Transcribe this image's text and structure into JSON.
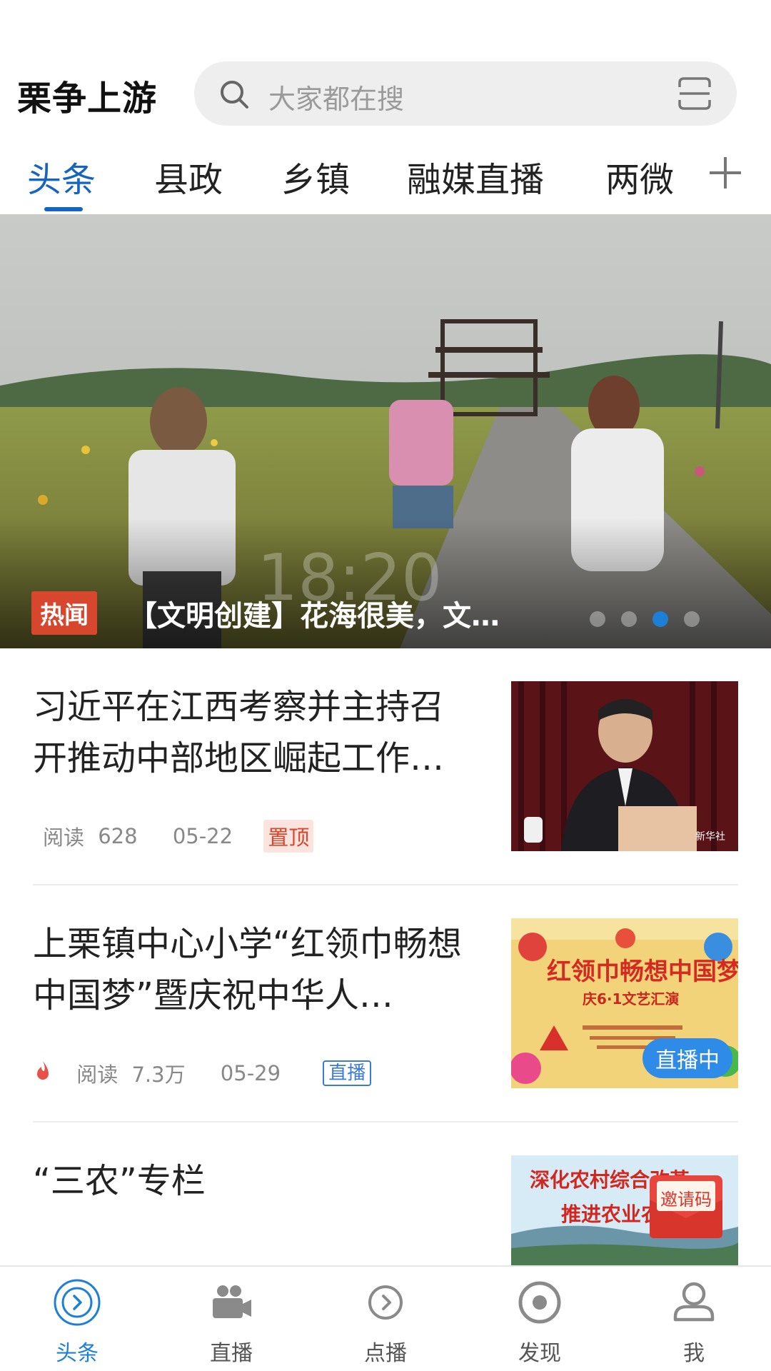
{
  "header": {
    "app_title": "栗争上游",
    "search_placeholder": "大家都在搜"
  },
  "tabs": [
    {
      "label": "头条",
      "active": true
    },
    {
      "label": "县政",
      "active": false
    },
    {
      "label": "乡镇",
      "active": false
    },
    {
      "label": "融媒直播",
      "active": false
    },
    {
      "label": "两微",
      "active": false
    }
  ],
  "hero": {
    "badge": "热闻",
    "title": "【文明创建】花海很美，文…",
    "overlay_time": "18:20",
    "dots_count": 4,
    "active_dot_index": 2
  },
  "news": [
    {
      "title": "习近平在江西考察并主持召开推动中部地区崛起工作…",
      "read_label": "阅读",
      "reads": "628",
      "date": "05-22",
      "tag": "置顶",
      "thumb_caption": "新华社"
    },
    {
      "title": "上栗镇中心小学“红领巾畅想中国梦”暨庆祝中华人…",
      "read_label": "阅读",
      "reads": "7.3万",
      "date": "05-29",
      "tag": "直播",
      "hot_icon": "flame-icon",
      "thumb_caption": "红领巾畅想中国梦",
      "thumb_sub": "庆6·1文艺汇演",
      "live_pill": "直播中"
    },
    {
      "title": "“三农”专栏",
      "thumb_caption": "深化农村综合改革",
      "thumb_sub": "推进农业农村"
    }
  ],
  "invite_badge": "邀请码",
  "bottom_nav": [
    {
      "label": "头条",
      "icon": "headline-icon",
      "active": true
    },
    {
      "label": "直播",
      "icon": "video-camera-icon",
      "active": false
    },
    {
      "label": "点播",
      "icon": "play-circle-icon",
      "active": false
    },
    {
      "label": "发现",
      "icon": "discover-icon",
      "active": false
    },
    {
      "label": "我",
      "icon": "user-icon",
      "active": false
    }
  ],
  "colors": {
    "accent": "#1565c0",
    "hot_red": "#d7472e",
    "live_blue": "#2f8be8"
  }
}
